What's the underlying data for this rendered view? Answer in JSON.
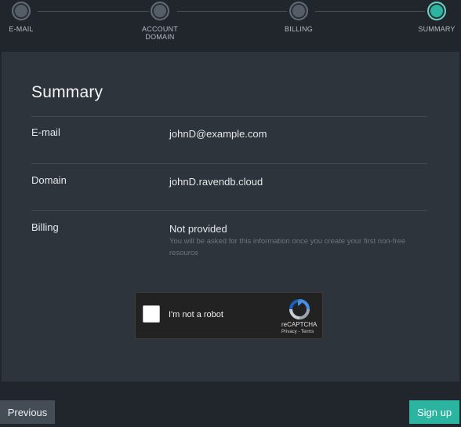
{
  "stepper": {
    "steps": [
      {
        "label_line1": "E-MAIL",
        "label_line2": ""
      },
      {
        "label_line1": "ACCOUNT",
        "label_line2": "DOMAIN"
      },
      {
        "label_line1": "BILLING",
        "label_line2": ""
      },
      {
        "label_line1": "SUMMARY",
        "label_line2": ""
      }
    ],
    "active_index": 3
  },
  "summary": {
    "title": "Summary",
    "email": {
      "label": "E-mail",
      "value": "johnD@example.com"
    },
    "domain": {
      "label": "Domain",
      "value": "johnD.ravendb.cloud"
    },
    "billing": {
      "label": "Billing",
      "value": "Not provided",
      "hint": "You will be asked for this information once you create your first non-free resource"
    }
  },
  "captcha": {
    "checkbox_label": "I'm not a robot",
    "brand": "reCAPTCHA",
    "links": "Privacy - Terms"
  },
  "buttons": {
    "previous_label": "Previous",
    "signup_label": "Sign up"
  },
  "colors": {
    "accent": "#2bb5a0",
    "background": "#21252c",
    "card": "#2e343b"
  }
}
